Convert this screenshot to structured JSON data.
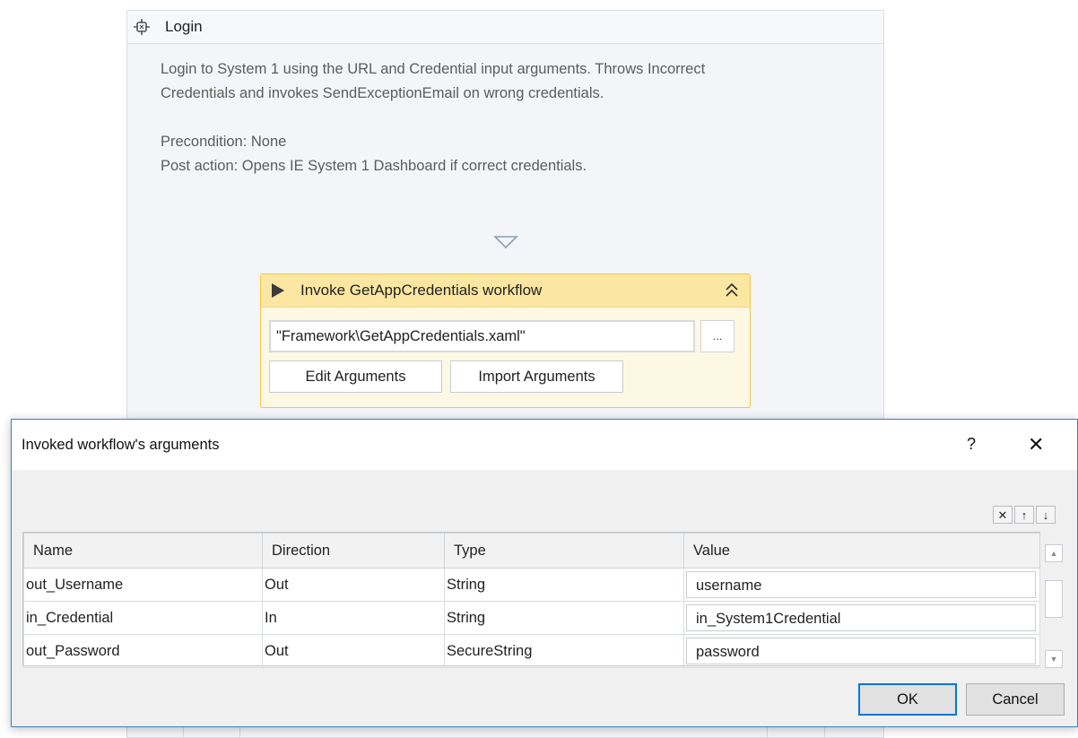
{
  "sequence": {
    "title": "Login",
    "icon": "sequence-icon",
    "annotation": {
      "line1": "Login to System 1 using the URL and Credential input arguments. Throws Incorrect",
      "line2": "Credentials and invokes SendExceptionEmail on wrong credentials.",
      "line3": "Precondition: None",
      "line4": "Post action: Opens IE System 1 Dashboard if correct credentials."
    }
  },
  "invoke": {
    "title": "Invoke GetAppCredentials workflow",
    "file_path": "\"Framework\\GetAppCredentials.xaml\"",
    "browse_label": "...",
    "edit_arguments_label": "Edit Arguments",
    "import_arguments_label": "Import Arguments"
  },
  "dialog": {
    "title": "Invoked workflow's arguments",
    "help_label": "?",
    "close_label": "✕",
    "tools": {
      "delete": "✕",
      "up": "↑",
      "down": "↓"
    },
    "columns": [
      "Name",
      "Direction",
      "Type",
      "Value"
    ],
    "rows": [
      {
        "name": "out_Username",
        "direction": "Out",
        "type": "String",
        "value": "username"
      },
      {
        "name": "in_Credential",
        "direction": "In",
        "type": "String",
        "value": "in_System1Credential"
      },
      {
        "name": "out_Password",
        "direction": "Out",
        "type": "SecureString",
        "value": "password"
      }
    ],
    "ok_label": "OK",
    "cancel_label": "Cancel"
  }
}
